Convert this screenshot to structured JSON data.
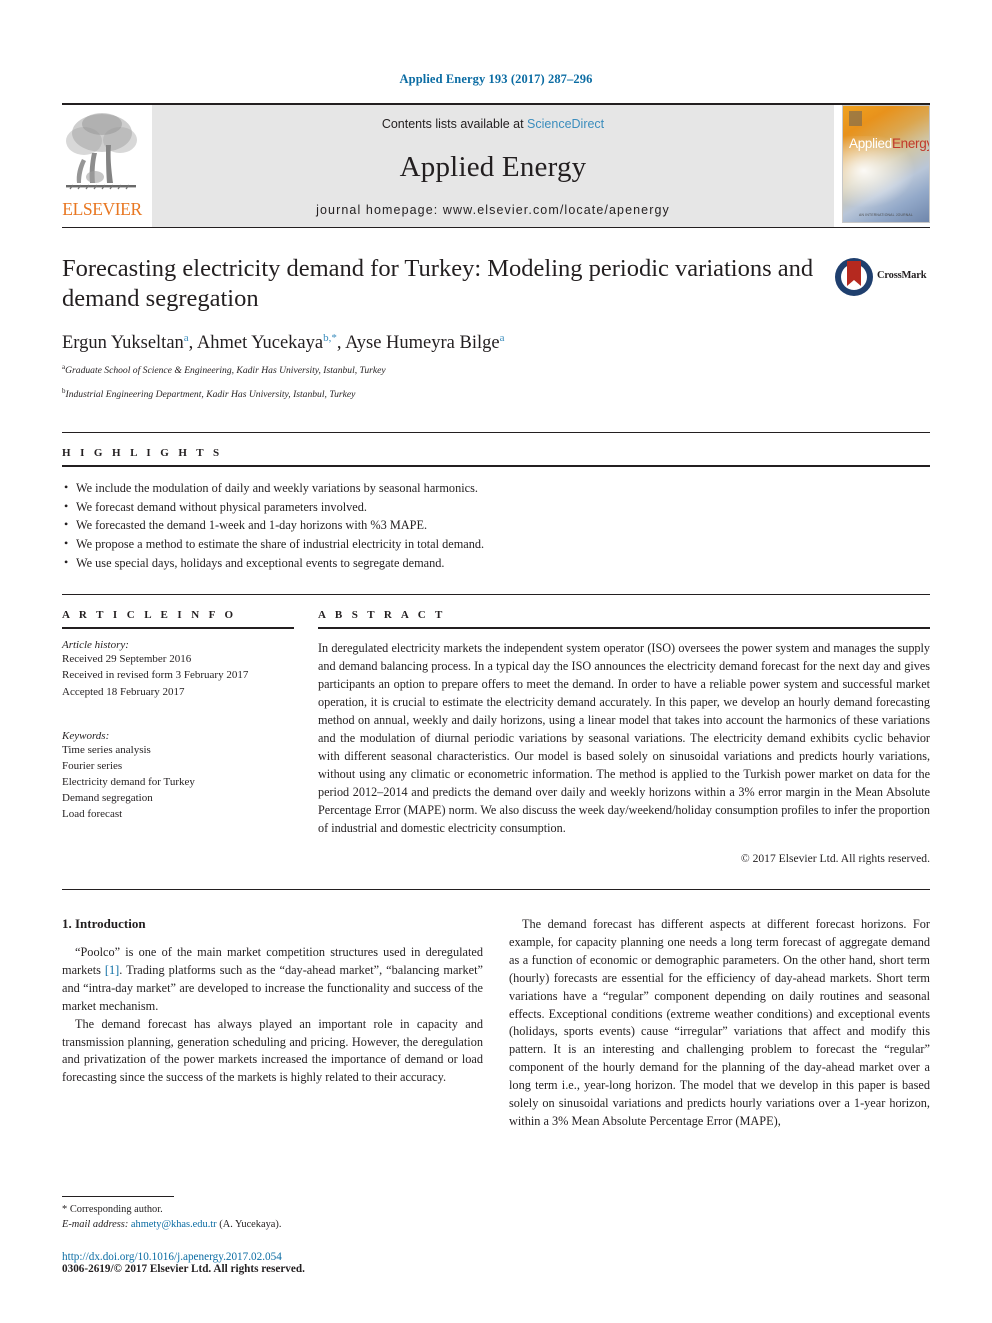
{
  "running_head": "Applied Energy 193 (2017) 287–296",
  "masthead": {
    "publisher_wordmark": "ELSEVIER",
    "contents_prefix": "Contents lists available at ",
    "contents_link": "ScienceDirect",
    "journal_title": "Applied Energy",
    "homepage": "journal homepage: www.elsevier.com/locate/apenergy",
    "cover_word_a": "Applied",
    "cover_word_b": "Energy",
    "cover_footer": "AN INTERNATIONAL JOURNAL"
  },
  "article": {
    "title": "Forecasting electricity demand for Turkey: Modeling periodic variations and demand segregation",
    "crossmark_label": "CrossMark",
    "authors": [
      {
        "name": "Ergun Yukseltan",
        "sup": "a",
        "sep": ", "
      },
      {
        "name": "Ahmet Yucekaya",
        "sup": "b,*",
        "sep": ", "
      },
      {
        "name": "Ayse Humeyra Bilge",
        "sup": "a",
        "sep": ""
      }
    ],
    "affiliations": [
      {
        "sup": "a",
        "text": "Graduate School of Science & Engineering, Kadir Has University, Istanbul, Turkey"
      },
      {
        "sup": "b",
        "text": "Industrial Engineering Department, Kadir Has University, Istanbul, Turkey"
      }
    ]
  },
  "highlights": {
    "heading": "H I G H L I G H T S",
    "items": [
      "We include the modulation of daily and weekly variations by seasonal harmonics.",
      "We forecast demand without physical parameters involved.",
      "We forecasted the demand 1-week and 1-day horizons with %3 MAPE.",
      "We propose a method to estimate the share of industrial electricity in total demand.",
      "We use special days, holidays and exceptional events to segregate demand."
    ]
  },
  "article_info": {
    "heading": "A R T I C L E    I N F O",
    "history_label": "Article history:",
    "history": [
      "Received 29 September 2016",
      "Received in revised form 3 February 2017",
      "Accepted 18 February 2017"
    ],
    "keywords_label": "Keywords:",
    "keywords": [
      "Time series analysis",
      "Fourier series",
      "Electricity demand for Turkey",
      "Demand segregation",
      "Load forecast"
    ]
  },
  "abstract": {
    "heading": "A B S T R A C T",
    "text": "In deregulated electricity markets the independent system operator (ISO) oversees the power system and manages the supply and demand balancing process. In a typical day the ISO announces the electricity demand forecast for the next day and gives participants an option to prepare offers to meet the demand. In order to have a reliable power system and successful market operation, it is crucial to estimate the electricity demand accurately. In this paper, we develop an hourly demand forecasting method on annual, weekly and daily horizons, using a linear model that takes into account the harmonics of these variations and the modulation of diurnal periodic variations by seasonal variations. The electricity demand exhibits cyclic behavior with different seasonal characteristics. Our model is based solely on sinusoidal variations and predicts hourly variations, without using any climatic or econometric information. The method is applied to the Turkish power market on data for the period 2012–2014 and predicts the demand over daily and weekly horizons within a 3% error margin in the Mean Absolute Percentage Error (MAPE) norm. We also discuss the week day/weekend/holiday consumption profiles to infer the proportion of industrial and domestic electricity consumption.",
    "copyright": "© 2017 Elsevier Ltd. All rights reserved."
  },
  "introduction": {
    "heading": "1. Introduction",
    "left_paragraphs": [
      "“Poolco” is one of the main market competition structures used in deregulated markets [1]. Trading platforms such as the “day-ahead market”, “balancing market” and “intra-day market” are developed to increase the functionality and success of the market mechanism.",
      "The demand forecast has always played an important role in capacity and transmission planning, generation scheduling and pricing. However, the deregulation and privatization of the power markets increased the importance of demand or load forecasting since the success of the markets is highly related to their accuracy."
    ],
    "citation_marker": "[1]",
    "right_paragraphs": [
      "The demand forecast has different aspects at different forecast horizons. For example, for capacity planning one needs a long term forecast of aggregate demand as a function of economic or demographic parameters. On the other hand, short term (hourly) forecasts are essential for the efficiency of day-ahead markets. Short term variations have a “regular” component depending on daily routines and seasonal effects. Exceptional conditions (extreme weather conditions) and exceptional events (holidays, sports events) cause “irregular” variations that affect and modify this pattern. It is an interesting and challenging problem to forecast the “regular” component of the hourly demand for the planning of the day-ahead market over a long term i.e., year-long horizon. The model that we develop in this paper is based solely on sinusoidal variations and predicts hourly variations over a 1-year horizon, within a 3% Mean Absolute Percentage Error (MAPE),"
    ]
  },
  "footer": {
    "corresponding_marker": "*",
    "corresponding_text": "Corresponding author.",
    "email_label": "E-mail address:",
    "email": "ahmety@khas.edu.tr",
    "email_owner": "(A. Yucekaya).",
    "doi": "http://dx.doi.org/10.1016/j.apenergy.2017.02.054",
    "issn": "0306-2619/© 2017 Elsevier Ltd. All rights reserved."
  },
  "colors": {
    "link": "#0b6ca3",
    "science_direct": "#3b8dbd",
    "elsevier_orange": "#e87722",
    "banner_bg": "#e6e6e6",
    "crossmark_blue": "#1f3f6e",
    "crossmark_red": "#b5291f"
  }
}
